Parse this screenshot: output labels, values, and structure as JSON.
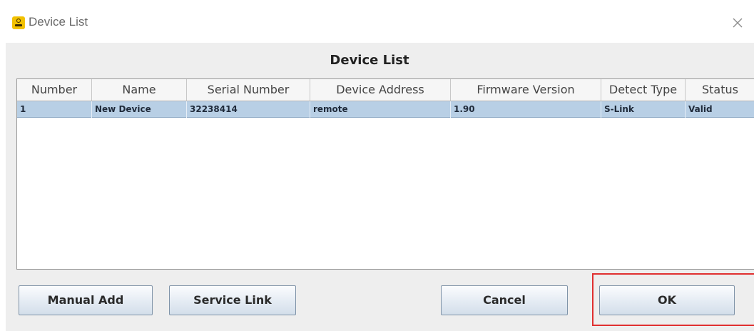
{
  "window": {
    "title": "Device List"
  },
  "dialog": {
    "heading": "Device List"
  },
  "table": {
    "columns": [
      "Number",
      "Name",
      "Serial Number",
      "Device Address",
      "Firmware Version",
      "Detect Type",
      "Status"
    ],
    "rows": [
      {
        "number": "1",
        "name": "New Device",
        "serial_number": "32238414",
        "device_address": "remote",
        "firmware_version": "1.90",
        "detect_type": "S-Link",
        "status": "Valid",
        "selected": true
      }
    ]
  },
  "buttons": {
    "manual_add": "Manual Add",
    "service_link": "Service Link",
    "cancel": "Cancel",
    "ok": "OK"
  },
  "colors": {
    "selected_row": "#b8cfe5",
    "highlight_border": "#e03030",
    "app_icon": "#f2c100"
  },
  "icons": {
    "app": "app-logo-icon",
    "close": "close-icon"
  }
}
